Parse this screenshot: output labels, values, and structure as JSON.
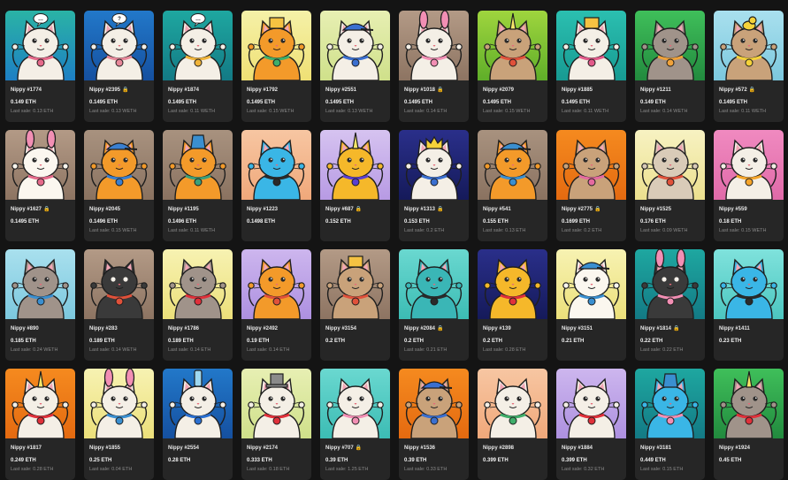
{
  "collection": {
    "items": [
      {
        "name": "Nippy #1774",
        "locked": false,
        "price": "0.149 ETH",
        "last_sale": "Last sale: 0.13 ETH",
        "bg": [
          "#2ab3a5",
          "#1d7fc4"
        ],
        "body": "#f4efe6",
        "eyes": "#2a2a2a",
        "accessory": "#e56a8a",
        "hat": "speech"
      },
      {
        "name": "Nippy #2395",
        "locked": true,
        "price": "0.1495 ETH",
        "last_sale": "Last sale: 0.13 WETH",
        "bg": [
          "#2278c9",
          "#1550a0"
        ],
        "body": "#f4efe6",
        "eyes": "#2a2a2a",
        "accessory": "#e8889a",
        "hat": "question"
      },
      {
        "name": "Nippy #1874",
        "locked": false,
        "price": "0.1495 ETH",
        "last_sale": "Last sale: 0.11 WETH",
        "bg": [
          "#1ea7a0",
          "#137a85"
        ],
        "body": "#f4efe6",
        "eyes": "#2a2a2a",
        "accessory": "#f0b43a",
        "hat": "speech"
      },
      {
        "name": "Nippy #1792",
        "locked": false,
        "price": "0.1495 ETH",
        "last_sale": "Last sale: 0.15 WETH",
        "bg": [
          "#f5f1a8",
          "#efe074"
        ],
        "body": "#f39a2a",
        "eyes": "#2a2a2a",
        "accessory": "#3fae6a",
        "hat": "box"
      },
      {
        "name": "Nippy #2551",
        "locked": false,
        "price": "0.1495 ETH",
        "last_sale": "Last sale: 0.13 WETH",
        "bg": [
          "#e7efb3",
          "#cfe08a"
        ],
        "body": "#f4efe6",
        "eyes": "#2a2a2a",
        "accessory": "#3a6fd0",
        "hat": "cap"
      },
      {
        "name": "Nippy #1018",
        "locked": true,
        "price": "0.1495 ETH",
        "last_sale": "Last sale: 0.14 ETH",
        "bg": [
          "#b39a86",
          "#8d7462"
        ],
        "body": "#f4efe6",
        "eyes": "#2a2a2a",
        "accessory": "#f28fb4",
        "hat": "bunny"
      },
      {
        "name": "Nippy #2079",
        "locked": false,
        "price": "0.1495 ETH",
        "last_sale": "Last sale: 0.15 WETH",
        "bg": [
          "#9fd53e",
          "#5fae29"
        ],
        "body": "#c9a27a",
        "eyes": "#2a2a2a",
        "accessory": "#e0513a",
        "hat": "unicorn"
      },
      {
        "name": "Nippy #1885",
        "locked": false,
        "price": "0.1495 ETH",
        "last_sale": "Last sale: 0.11 WETH",
        "bg": [
          "#2bbfb0",
          "#179a92"
        ],
        "body": "#f4efe6",
        "eyes": "#2a2a2a",
        "accessory": "#e25a8a",
        "hat": "box"
      },
      {
        "name": "Nippy #1211",
        "locked": false,
        "price": "0.149 ETH",
        "last_sale": "Last sale: 0.14 WETH",
        "bg": [
          "#3fbf5a",
          "#228a3e"
        ],
        "body": "#a0938a",
        "eyes": "#2a2a2a",
        "accessory": "#f0a23a",
        "hat": "none"
      },
      {
        "name": "Nippy #572",
        "locked": true,
        "price": "0.1495 ETH",
        "last_sale": "Last sale: 0.11 WETH",
        "bg": [
          "#a9e0ee",
          "#7cc8de"
        ],
        "body": "#c9a27a",
        "eyes": "#2a2a2a",
        "accessory": "#f5d23a",
        "hat": "duck"
      },
      {
        "name": "Nippy #1627",
        "locked": true,
        "price": "0.1495 ETH",
        "last_sale": "",
        "bg": [
          "#b39a86",
          "#8d7462"
        ],
        "body": "#fbf7ef",
        "eyes": "#2a2a2a",
        "accessory": "#e56a8a",
        "hat": "bunny"
      },
      {
        "name": "Nippy #2045",
        "locked": false,
        "price": "0.1496 ETH",
        "last_sale": "Last sale: 0.15 WETH",
        "bg": [
          "#a8927f",
          "#8a7260"
        ],
        "body": "#f39a2a",
        "eyes": "#2a2a2a",
        "accessory": "#3a7fd0",
        "hat": "cap"
      },
      {
        "name": "Nippy #1195",
        "locked": false,
        "price": "0.1496 ETH",
        "last_sale": "Last sale: 0.11 WETH",
        "bg": [
          "#a8927f",
          "#8a7260"
        ],
        "body": "#f39a2a",
        "eyes": "#2a2a2a",
        "accessory": "#3aa07a",
        "hat": "bucket"
      },
      {
        "name": "Nippy #1223",
        "locked": false,
        "price": "0.1498 ETH",
        "last_sale": "",
        "bg": [
          "#f7c6a2",
          "#f0a87a"
        ],
        "body": "#3ab6e6",
        "eyes": "#2a2a2a",
        "accessory": "#2a2a2a",
        "hat": "none"
      },
      {
        "name": "Nippy #687",
        "locked": true,
        "price": "0.152 ETH",
        "last_sale": "",
        "bg": [
          "#d6c3f0",
          "#b79ae4"
        ],
        "body": "#f5b82a",
        "eyes": "#2a2a2a",
        "accessory": "#5a3fd0",
        "hat": "unicorn"
      },
      {
        "name": "Nippy #1313",
        "locked": true,
        "price": "0.153 ETH",
        "last_sale": "Last sale: 0.2 ETH",
        "bg": [
          "#2a2f8a",
          "#151a5a"
        ],
        "body": "#f4efe6",
        "eyes": "#2a2a2a",
        "accessory": "#3a6fd0",
        "hat": "crown"
      },
      {
        "name": "Nippy #541",
        "locked": false,
        "price": "0.155 ETH",
        "last_sale": "Last sale: 0.13 ETH",
        "bg": [
          "#a8927f",
          "#8a7260"
        ],
        "body": "#f39a2a",
        "eyes": "#2a2a2a",
        "accessory": "#3a8fd0",
        "hat": "cap"
      },
      {
        "name": "Nippy #2775",
        "locked": true,
        "price": "0.1699 ETH",
        "last_sale": "Last sale: 0.2 ETH",
        "bg": [
          "#f58a1f",
          "#e46a10"
        ],
        "body": "#c9a27a",
        "eyes": "#2a2a2a",
        "accessory": "#e56aa0",
        "hat": "none"
      },
      {
        "name": "Nippy #1525",
        "locked": false,
        "price": "0.176 ETH",
        "last_sale": "Last sale: 0.09 WETH",
        "bg": [
          "#f7f2c2",
          "#ece08e"
        ],
        "body": "#d9cbb8",
        "eyes": "#2a2a2a",
        "accessory": "#e0513a",
        "hat": "none"
      },
      {
        "name": "Nippy #559",
        "locked": false,
        "price": "0.18 ETH",
        "last_sale": "Last sale: 0.15 WETH",
        "bg": [
          "#f08ac0",
          "#e06aa8"
        ],
        "body": "#f4efe6",
        "eyes": "#2a2a2a",
        "accessory": "#f5a52a",
        "hat": "none"
      },
      {
        "name": "Nippy #890",
        "locked": false,
        "price": "0.185 ETH",
        "last_sale": "Last sale: 0.24 WETH",
        "bg": [
          "#a9e0ee",
          "#7cc8de"
        ],
        "body": "#a0938a",
        "eyes": "#2a2a2a",
        "accessory": "#3a8fd0",
        "hat": "none"
      },
      {
        "name": "Nippy #283",
        "locked": false,
        "price": "0.189 ETH",
        "last_sale": "Last sale: 0.14 WETH",
        "bg": [
          "#b39a86",
          "#8d7462"
        ],
        "body": "#3a3a3a",
        "eyes": "#f4efe6",
        "accessory": "#e0513a",
        "hat": "none"
      },
      {
        "name": "Nippy #1786",
        "locked": false,
        "price": "0.189 ETH",
        "last_sale": "Last sale: 0.14 ETH",
        "bg": [
          "#f7f2b2",
          "#ece07a"
        ],
        "body": "#a0938a",
        "eyes": "#2a2a2a",
        "accessory": "#e0303a",
        "hat": "none"
      },
      {
        "name": "Nippy #2492",
        "locked": false,
        "price": "0.19 ETH",
        "last_sale": "Last sale: 0.14 ETH",
        "bg": [
          "#cdb6ee",
          "#ad90e0"
        ],
        "body": "#f39a2a",
        "eyes": "#2a2a2a",
        "accessory": "#e0513a",
        "hat": "none"
      },
      {
        "name": "Nippy #3154",
        "locked": false,
        "price": "0.2 ETH",
        "last_sale": "",
        "bg": [
          "#b39a86",
          "#8d7462"
        ],
        "body": "#c9a27a",
        "eyes": "#2a2a2a",
        "accessory": "#e0513a",
        "hat": "box"
      },
      {
        "name": "Nippy #2084",
        "locked": true,
        "price": "0.2 ETH",
        "last_sale": "Last sale: 0.21 ETH",
        "bg": [
          "#6ad8d0",
          "#3cbcb4"
        ],
        "body": "#3ab6b6",
        "eyes": "#2a2a2a",
        "accessory": "#2a2a2a",
        "hat": "none"
      },
      {
        "name": "Nippy #139",
        "locked": false,
        "price": "0.2 ETH",
        "last_sale": "Last sale: 0.28 ETH",
        "bg": [
          "#2a2f8a",
          "#151a5a"
        ],
        "body": "#f5b82a",
        "eyes": "#2a2a2a",
        "accessory": "#e0303a",
        "hat": "none"
      },
      {
        "name": "Nippy #3151",
        "locked": false,
        "price": "0.21 ETH",
        "last_sale": "",
        "bg": [
          "#f7f2b2",
          "#ece07a"
        ],
        "body": "#fbf7ef",
        "eyes": "#2a2a2a",
        "accessory": "#3a8fd0",
        "hat": "cap"
      },
      {
        "name": "Nippy #1814",
        "locked": true,
        "price": "0.22 ETH",
        "last_sale": "Last sale: 0.22 ETH",
        "bg": [
          "#1ea7a0",
          "#137a85"
        ],
        "body": "#3a3a3a",
        "eyes": "#f4efe6",
        "accessory": "#f28fb4",
        "hat": "bunny"
      },
      {
        "name": "Nippy #1411",
        "locked": false,
        "price": "0.23 ETH",
        "last_sale": "",
        "bg": [
          "#7fe2dc",
          "#4cc6c0"
        ],
        "body": "#3ab6e6",
        "eyes": "#2a2a2a",
        "accessory": "#2a2a2a",
        "hat": "none"
      },
      {
        "name": "Nippy #1817",
        "locked": false,
        "price": "0.249 ETH",
        "last_sale": "Last sale: 0.28 ETH",
        "bg": [
          "#f58a1f",
          "#e46a10"
        ],
        "body": "#f4efe6",
        "eyes": "#2a2a2a",
        "accessory": "#e0303a",
        "hat": "unicorn"
      },
      {
        "name": "Nippy #1855",
        "locked": false,
        "price": "0.25 ETH",
        "last_sale": "Last sale: 0.04 ETH",
        "bg": [
          "#f7f2b2",
          "#ece07a"
        ],
        "body": "#f4efe6",
        "eyes": "#2a2a2a",
        "accessory": "#3a8fd0",
        "hat": "bunny"
      },
      {
        "name": "Nippy #2554",
        "locked": false,
        "price": "0.28 ETH",
        "last_sale": "",
        "bg": [
          "#2278c9",
          "#1550a0"
        ],
        "body": "#f4efe6",
        "eyes": "#2a2a2a",
        "accessory": "#2a6fd0",
        "hat": "bottle"
      },
      {
        "name": "Nippy #2174",
        "locked": false,
        "price": "0.333 ETH",
        "last_sale": "Last sale: 0.18 ETH",
        "bg": [
          "#e7efb3",
          "#cfe08a"
        ],
        "body": "#f4efe6",
        "eyes": "#2a2a2a",
        "accessory": "#e0303a",
        "hat": "tophat"
      },
      {
        "name": "Nippy #707",
        "locked": true,
        "price": "0.39 ETH",
        "last_sale": "Last sale: 1.25 ETH",
        "bg": [
          "#6ad8d0",
          "#3cbcb4"
        ],
        "body": "#f4efe6",
        "eyes": "#2a2a2a",
        "accessory": "#f28fb4",
        "hat": "none"
      },
      {
        "name": "Nippy #1536",
        "locked": false,
        "price": "0.39 ETH",
        "last_sale": "Last sale: 0.33 ETH",
        "bg": [
          "#f58a1f",
          "#e46a10"
        ],
        "body": "#c9a27a",
        "eyes": "#2a2a2a",
        "accessory": "#3a6fd0",
        "hat": "cap"
      },
      {
        "name": "Nippy #2898",
        "locked": false,
        "price": "0.399 ETH",
        "last_sale": "",
        "bg": [
          "#f7c6a2",
          "#f0a87a"
        ],
        "body": "#f4efe6",
        "eyes": "#2a2a2a",
        "accessory": "#3fae6a",
        "hat": "none"
      },
      {
        "name": "Nippy #1884",
        "locked": false,
        "price": "0.399 ETH",
        "last_sale": "Last sale: 0.32 ETH",
        "bg": [
          "#cdb6ee",
          "#ad90e0"
        ],
        "body": "#f4efe6",
        "eyes": "#2a2a2a",
        "accessory": "#e0303a",
        "hat": "none"
      },
      {
        "name": "Nippy #3181",
        "locked": false,
        "price": "0.449 ETH",
        "last_sale": "Last sale: 0.15 ETH",
        "bg": [
          "#1ea7a0",
          "#137a85"
        ],
        "body": "#3ab6e6",
        "eyes": "#2a2a2a",
        "accessory": "#f28fb4",
        "hat": "bucket"
      },
      {
        "name": "Nippy #1924",
        "locked": false,
        "price": "0.45 ETH",
        "last_sale": "",
        "bg": [
          "#3fbf5a",
          "#228a3e"
        ],
        "body": "#a0938a",
        "eyes": "#2a2a2a",
        "accessory": "#e0303a",
        "hat": "unicorn"
      }
    ]
  }
}
